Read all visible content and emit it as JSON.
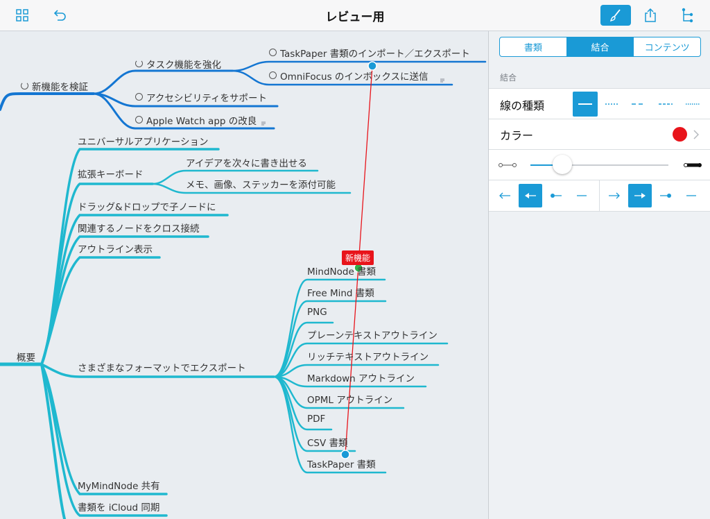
{
  "header": {
    "title": "レビュー用"
  },
  "colors": {
    "accent": "#1a9ad6",
    "dark_branch": "#1476d2",
    "cyan_branch": "#1fb8cf",
    "connection": "#e8141b"
  },
  "toolbar": {
    "left": [
      {
        "icon": "grid-icon"
      },
      {
        "icon": "undo-icon"
      }
    ],
    "right": [
      {
        "icon": "brush-icon",
        "active": true
      },
      {
        "icon": "share-icon"
      },
      {
        "icon": "outline-icon"
      }
    ]
  },
  "mindmap": {
    "dark_nodes": [
      {
        "label": "新機能を検証",
        "checkbox": "partial"
      },
      {
        "label": "タスク機能を強化",
        "checkbox": "partial"
      },
      {
        "label": "TaskPaper 書類のインポート／エクスポート",
        "checkbox": "empty"
      },
      {
        "label": "OmniFocus のインボックスに送信",
        "checkbox": "empty"
      },
      {
        "label": "アクセシビリティをサポート",
        "checkbox": "empty"
      },
      {
        "label": "Apple Watch app の改良",
        "checkbox": "empty"
      }
    ],
    "cyan_nodes": [
      "ユニバーサルアプリケーション",
      "拡張キーボード",
      "アイデアを次々に書き出せる",
      "メモ、画像、ステッカーを添付可能",
      "ドラッグ&ドロップで子ノードに",
      "関連するノードをクロス接続",
      "アウトライン表示",
      "概要",
      "さまざまなフォーマットでエクスポート",
      "MindNode 書類",
      "Free Mind 書類",
      "PNG",
      "プレーンテキストアウトライン",
      "リッチテキストアウトライン",
      "Markdown アウトライン",
      "OPML アウトライン",
      "PDF",
      "CSV 書類",
      "TaskPaper 書類",
      "MyMindNode 共有",
      "書類を iCloud 同期"
    ],
    "connection_label": "新機能"
  },
  "inspector": {
    "tabs": [
      {
        "label": "書類"
      },
      {
        "label": "結合",
        "selected": true
      },
      {
        "label": "コンテンツ"
      }
    ],
    "section": "結合",
    "line_type_label": "線の種類",
    "color_label": "カラー",
    "color_value": "#e8141b",
    "width_fraction": 0.06
  }
}
